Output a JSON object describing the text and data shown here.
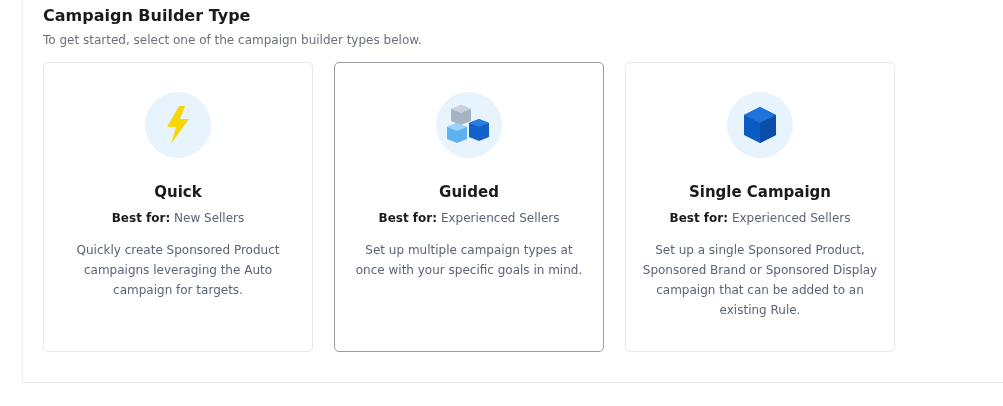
{
  "section": {
    "title": "Campaign Builder Type",
    "subtitle": "To get started, select one of the campaign builder types below."
  },
  "cards": [
    {
      "kind": "bolt",
      "title": "Quick",
      "best_for_label": "Best for:",
      "best_for": "New Sellers",
      "description": "Quickly create Sponsored Product campaigns leveraging the Auto campaign for targets.",
      "hovered": false
    },
    {
      "kind": "cubes",
      "title": "Guided",
      "best_for_label": "Best for:",
      "best_for": "Experienced Sellers",
      "description": "Set up multiple campaign types at once with your specific goals in mind.",
      "hovered": true
    },
    {
      "kind": "cube",
      "title": "Single Campaign",
      "best_for_label": "Best for:",
      "best_for": "Experienced Sellers",
      "description": "Set up a single Sponsored Product, Sponsored Brand or Sponsored Display campaign that can be added to an existing Rule.",
      "hovered": false
    }
  ]
}
